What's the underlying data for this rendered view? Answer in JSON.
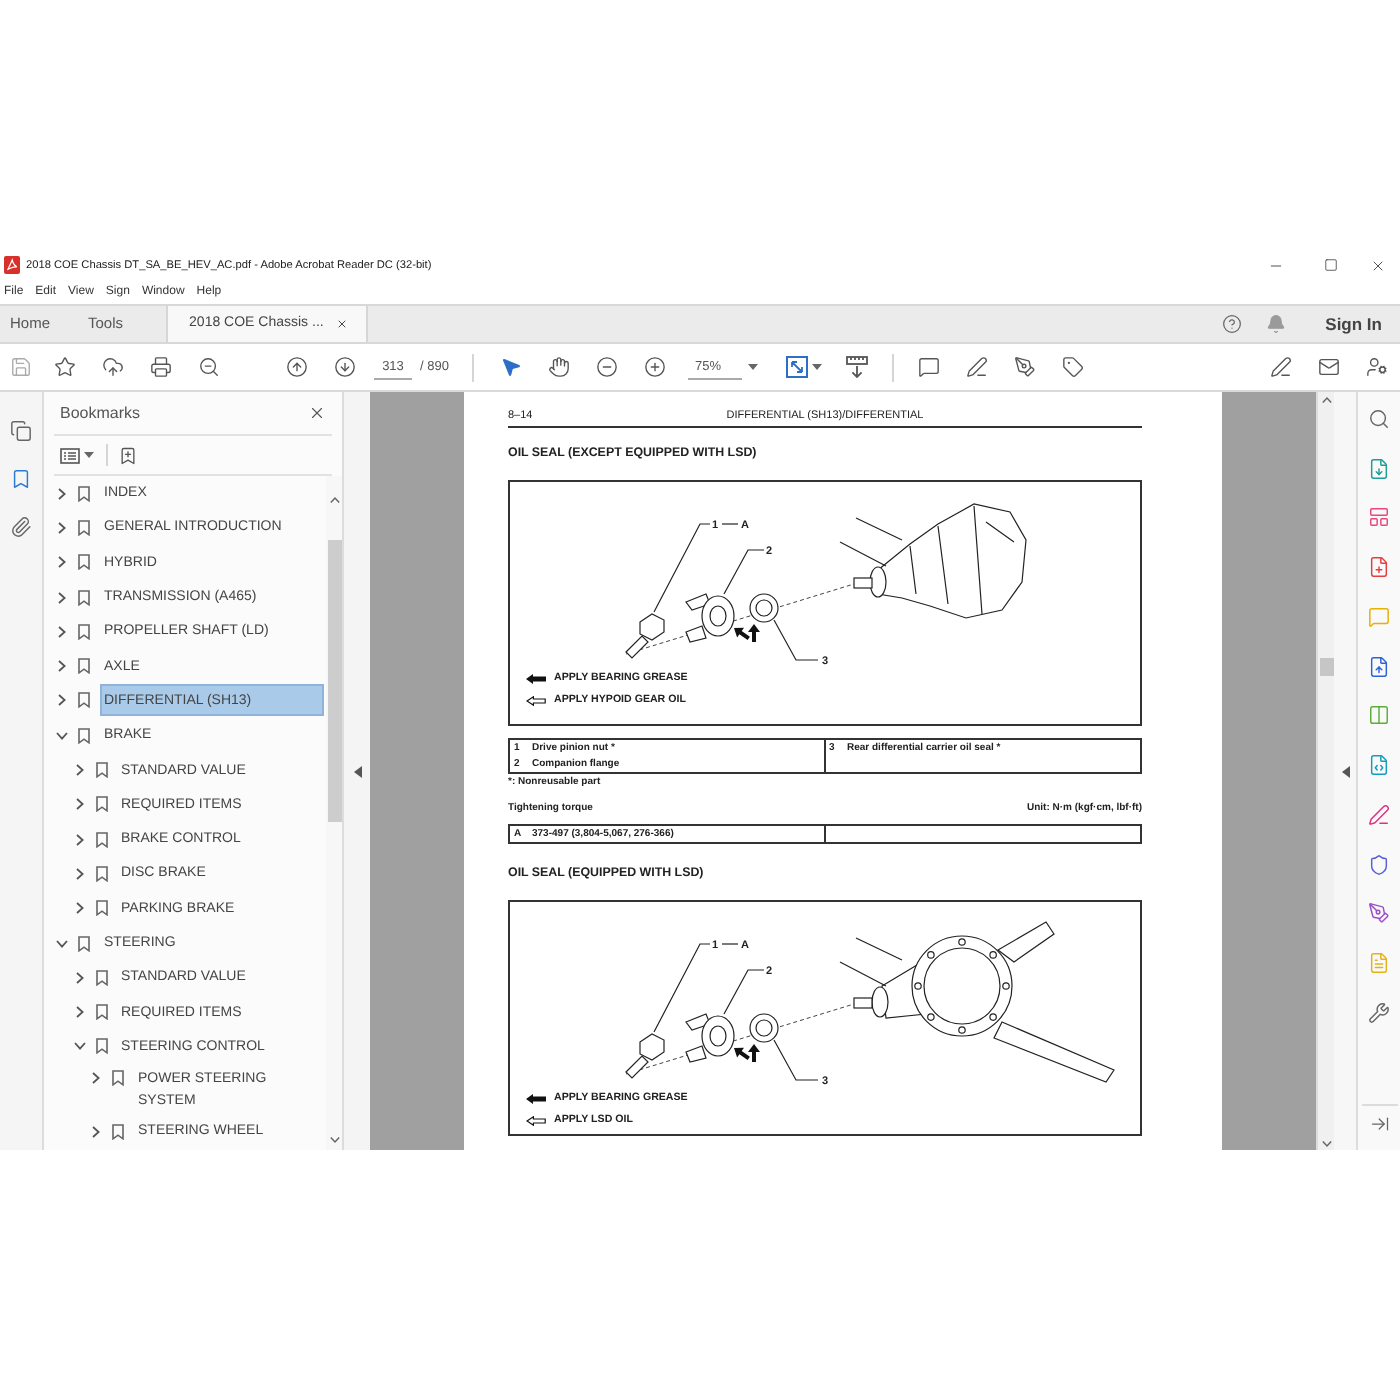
{
  "window": {
    "title": "2018 COE Chassis DT_SA_BE_HEV_AC.pdf - Adobe Acrobat Reader DC (32-bit)"
  },
  "menu": [
    "File",
    "Edit",
    "View",
    "Sign",
    "Window",
    "Help"
  ],
  "tabs": [
    {
      "label": "Home",
      "selected": false,
      "closable": false
    },
    {
      "label": "Tools",
      "selected": false,
      "closable": false
    },
    {
      "label": "2018 COE Chassis ...",
      "selected": true,
      "closable": true
    }
  ],
  "account": {
    "sign_in": "Sign In"
  },
  "toolbar": {
    "page": "313",
    "page_count": "/ 890",
    "zoom": "75%"
  },
  "side_rail": [
    {
      "kind": "pages",
      "selected": false
    },
    {
      "kind": "bookmarks",
      "selected": true
    },
    {
      "kind": "attachments",
      "selected": false
    }
  ],
  "bookmarks": {
    "title": "Bookmarks",
    "items": [
      {
        "label": "INDEX",
        "expanded": false,
        "selected": false
      },
      {
        "label": "GENERAL INTRODUCTION",
        "expanded": false,
        "selected": false
      },
      {
        "label": "HYBRID",
        "expanded": false,
        "selected": false
      },
      {
        "label": "TRANSMISSION (A465)",
        "expanded": false,
        "selected": false
      },
      {
        "label": "PROPELLER SHAFT (LD)",
        "expanded": false,
        "selected": false
      },
      {
        "label": "AXLE",
        "expanded": false,
        "selected": false
      },
      {
        "label": "DIFFERENTIAL (SH13)",
        "expanded": false,
        "selected": true
      },
      {
        "label": "BRAKE",
        "expanded": true,
        "selected": false,
        "children": [
          {
            "label": "STANDARD VALUE",
            "expanded": false,
            "selected": false
          },
          {
            "label": "REQUIRED ITEMS",
            "expanded": false,
            "selected": false
          },
          {
            "label": "BRAKE CONTROL",
            "expanded": false,
            "selected": false
          },
          {
            "label": "DISC BRAKE",
            "expanded": false,
            "selected": false
          },
          {
            "label": "PARKING BRAKE",
            "expanded": false,
            "selected": false
          }
        ]
      },
      {
        "label": "STEERING",
        "expanded": true,
        "selected": false,
        "children": [
          {
            "label": "STANDARD VALUE",
            "expanded": false,
            "selected": false
          },
          {
            "label": "REQUIRED ITEMS",
            "expanded": false,
            "selected": false
          },
          {
            "label": "STEERING CONTROL",
            "expanded": true,
            "selected": false,
            "children": [
              {
                "label": "POWER STEERING SYSTEM",
                "expanded": false,
                "selected": false
              },
              {
                "label": "STEERING WHEEL",
                "expanded": false,
                "selected": false
              }
            ]
          }
        ]
      }
    ]
  },
  "document": {
    "page_number": "8–14",
    "running_title": "DIFFERENTIAL (SH13)/DIFFERENTIAL",
    "sections": [
      {
        "heading": "OIL SEAL (EXCEPT EQUIPPED WITH LSD)",
        "figure": {
          "kind": "standard",
          "callouts": [
            "1",
            "A",
            "2",
            "3"
          ],
          "legend": [
            {
              "kind": "filled",
              "text": "APPLY BEARING GREASE"
            },
            {
              "kind": "outline",
              "text": "APPLY HYPOID GEAR OIL"
            }
          ]
        },
        "parts": {
          "left": [
            {
              "no": "1",
              "name": "Drive pinion nut *"
            },
            {
              "no": "2",
              "name": "Companion flange"
            }
          ],
          "right": [
            {
              "no": "3",
              "name": "Rear differential carrier oil seal *"
            }
          ]
        },
        "note": "*: Nonreusable part",
        "torque": {
          "label": "Tightening torque",
          "unit": "Unit: N·m (kgf·cm, lbf·ft)",
          "rows": [
            {
              "no": "A",
              "value": "373-497 (3,804-5,067, 276-366)"
            }
          ]
        }
      },
      {
        "heading": "OIL SEAL (EQUIPPED WITH LSD)",
        "figure": {
          "kind": "lsd",
          "callouts": [
            "1",
            "A",
            "2",
            "3"
          ],
          "legend": [
            {
              "kind": "filled",
              "text": "APPLY BEARING GREASE"
            },
            {
              "kind": "outline",
              "text": "APPLY LSD OIL"
            }
          ]
        }
      }
    ]
  }
}
